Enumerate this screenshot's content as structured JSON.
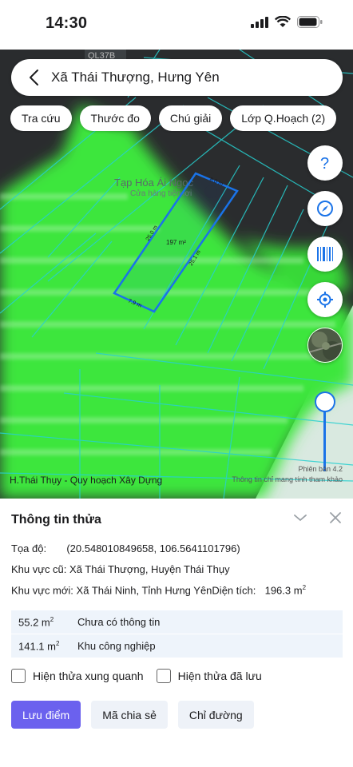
{
  "status_bar": {
    "time": "14:30"
  },
  "search": {
    "text": "Xã Thái Thượng, Hưng Yên"
  },
  "chips": [
    "Tra cứu",
    "Thước đo",
    "Chú giải",
    "Lớp Q.Hoạch (2)"
  ],
  "fab_icons": [
    "help-icon",
    "compass-icon",
    "barcode-icon",
    "my-location-icon",
    "satellite-layer-icon"
  ],
  "map": {
    "poi_name": "Tạp Hóa Ái Ngọc",
    "poi_sub": "Cửa hàng tiện lợi",
    "road_label": "QL37B",
    "parcel_area": "197 m²",
    "edge_top": "8.0 m",
    "edge_left": "25.0 m",
    "edge_right": "25.1 m",
    "edge_bottom": "7.9 m",
    "bottom_left_label": "H.Thái Thụy - Quy hoạch Xây Dựng",
    "version": "Phiên bản 4.2",
    "note": "Thông tin chỉ mang tính tham khảo",
    "overlay_color": "#33e833",
    "parcel_color": "#1a73e8"
  },
  "panel": {
    "title": "Thông tin thửa",
    "coord_label": "Tọa độ:",
    "coord_value": "(20.548010849658, 106.5641101796)",
    "old_area_label": "Khu vực cũ:",
    "old_area_value": "Xã Thái Thượng, Huyện Thái Thụy",
    "new_area_label": "Khu vực mới:",
    "new_area_value": "Xã Thái Ninh, Tỉnh Hưng Yên",
    "acreage_label": "Diện tích:",
    "acreage_value": "196.3 m",
    "acreage_unit_sup": "2",
    "rows": [
      {
        "area": "55.2 m",
        "desc": "Chưa có thông tin"
      },
      {
        "area": "141.1 m",
        "desc": "Khu công nghiệp"
      }
    ],
    "check_surrounding": "Hiện thửa xung quanh",
    "check_saved": "Hiện thửa đã lưu",
    "btn_save": "Lưu điểm",
    "btn_share": "Mã chia sẻ",
    "btn_directions": "Chỉ đường"
  }
}
